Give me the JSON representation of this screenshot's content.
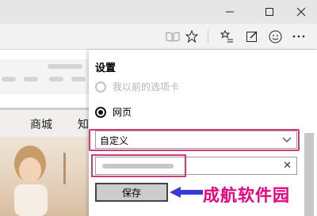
{
  "panel": {
    "title": "设置",
    "radio_options": [
      {
        "label": "我以前的选项卡",
        "selected": false
      },
      {
        "label": "网页",
        "selected": true
      }
    ],
    "dropdown_value": "自定义",
    "save_label": "保存"
  },
  "webpage": {
    "nav_items": [
      "商城",
      "知"
    ]
  },
  "watermark": "成航软件园",
  "colors": {
    "highlight": "#d2397c",
    "arrow": "#3a3ad8",
    "watermark": "#e6007e"
  }
}
